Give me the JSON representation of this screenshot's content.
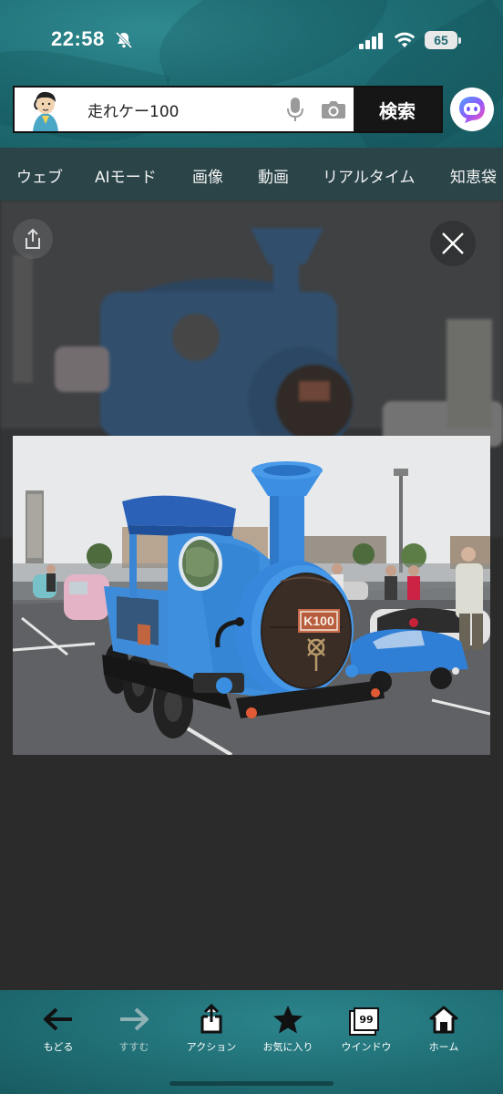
{
  "status_bar": {
    "time": "22:58",
    "battery": "65",
    "icons": [
      "bell-off-icon",
      "signal-icon",
      "wifi-icon",
      "battery-icon"
    ]
  },
  "search": {
    "query": "走れケー100",
    "button_label": "検索",
    "icons": [
      "mic-icon",
      "camera-icon",
      "ai-assistant-icon"
    ]
  },
  "tabs": [
    {
      "label": "ウェブ",
      "active": false
    },
    {
      "label": "AIモード",
      "active": false
    },
    {
      "label": "画像",
      "active": true
    },
    {
      "label": "動画",
      "active": false
    },
    {
      "label": "リアルタイム",
      "active": false
    },
    {
      "label": "知恵袋",
      "active": false
    }
  ],
  "viewer": {
    "plate_text": "K100",
    "icons": [
      "close-icon",
      "share-icon"
    ]
  },
  "toolbar": {
    "items": [
      {
        "label": "もどる",
        "icon": "back-arrow-icon",
        "enabled": true
      },
      {
        "label": "すすむ",
        "icon": "forward-arrow-icon",
        "enabled": false
      },
      {
        "label": "アクション",
        "icon": "share-action-icon",
        "enabled": true
      },
      {
        "label": "お気に入り",
        "icon": "star-icon",
        "enabled": true
      },
      {
        "label": "ウインドウ",
        "icon": "windows-icon",
        "enabled": true,
        "count": "99"
      },
      {
        "label": "ホーム",
        "icon": "home-icon",
        "enabled": true
      }
    ]
  },
  "colors": {
    "teal": "#1f6f76",
    "tab_bar": "#2a4448",
    "background": "#2b2b2b",
    "locomotive_blue": "#3b86d6"
  }
}
